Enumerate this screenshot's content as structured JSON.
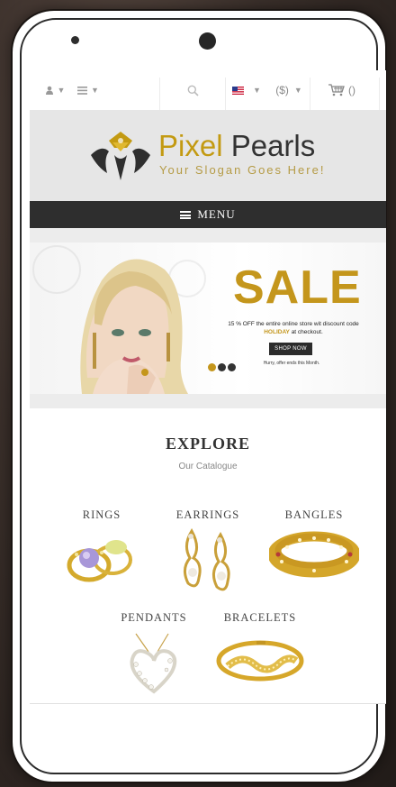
{
  "topbar": {
    "account_icon": "user-icon",
    "menu_icon": "list-icon",
    "search_icon": "search-icon",
    "flag_icon": "us-flag-icon",
    "currency": "($)",
    "cart_icon": "cart-icon",
    "cart_count": "()"
  },
  "header": {
    "brand_part1": "Pixel",
    "brand_part2": "Pearls",
    "slogan": "Your Slogan Goes Here!"
  },
  "menu": {
    "label": "MENU"
  },
  "slider": {
    "sale_title": "SALE",
    "promo_before": "15 % OFF the entire online store wit discount code ",
    "promo_code": "HOLIDAY",
    "promo_after": " at checkout.",
    "button_label": "SHOP NOW",
    "note": "Hurry, offer ends this Month.",
    "dots": 3,
    "active_dot": 0
  },
  "explore": {
    "title": "EXPLORE",
    "subtitle": "Our Catalogue"
  },
  "categories": [
    {
      "label": "RINGS"
    },
    {
      "label": "EARRINGS"
    },
    {
      "label": "BANGLES"
    },
    {
      "label": "PENDANTS"
    },
    {
      "label": "BRACELETS"
    }
  ],
  "colors": {
    "accent_gold": "#c4961c",
    "menu_bar": "#2e2e2e",
    "header_bg": "#e6e6e6"
  }
}
